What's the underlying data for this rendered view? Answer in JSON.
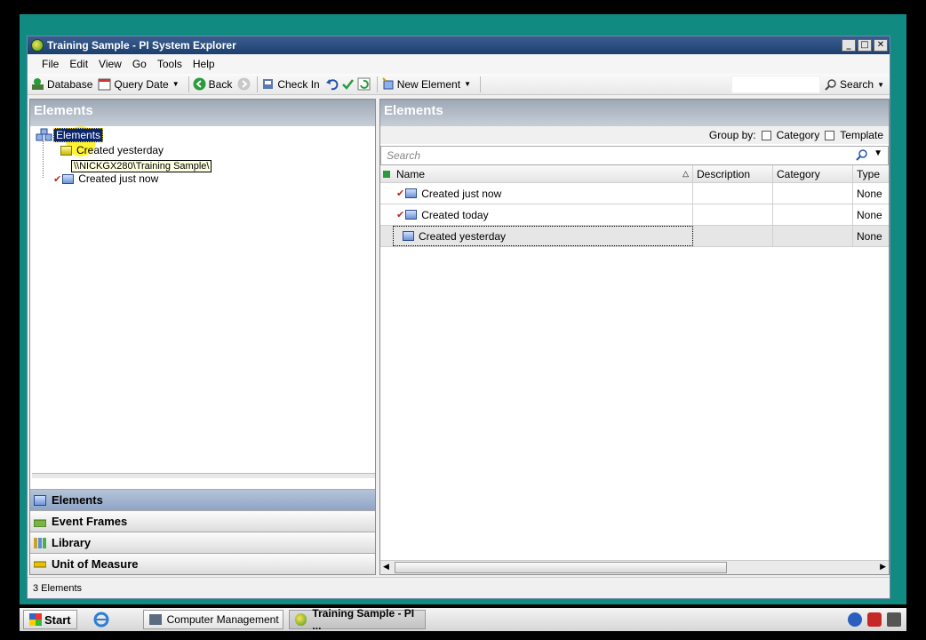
{
  "window": {
    "title": "Training Sample - PI System Explorer",
    "controls": {
      "minimize": "_",
      "maximize": "□",
      "close": "✕"
    }
  },
  "menu": [
    "File",
    "Edit",
    "View",
    "Go",
    "Tools",
    "Help"
  ],
  "toolbar": {
    "database": "Database",
    "query_date": "Query Date",
    "back": "Back",
    "check_in": "Check In",
    "new_element": "New Element",
    "search": "Search"
  },
  "left": {
    "header": "Elements",
    "tree_root": "Elements",
    "tree_items": [
      "Created yesterday",
      "Created just now"
    ],
    "tooltip": "\\\\NICKGX280\\Training Sample\\"
  },
  "nav": [
    "Elements",
    "Event Frames",
    "Library",
    "Unit of Measure"
  ],
  "right": {
    "header": "Elements",
    "group_by": "Group by:",
    "category": "Category",
    "template": "Template",
    "search_placeholder": "Search",
    "columns": [
      "Name",
      "Description",
      "Category",
      "Type"
    ],
    "rows": [
      {
        "name": "Created just now",
        "description": "",
        "category": "",
        "type": "None",
        "checked": true
      },
      {
        "name": "Created today",
        "description": "",
        "category": "",
        "type": "None",
        "checked": true
      },
      {
        "name": "Created yesterday",
        "description": "",
        "category": "",
        "type": "None",
        "checked": false
      }
    ]
  },
  "status": "3 Elements",
  "taskbar": {
    "start": "Start",
    "tasks": [
      "Computer Management",
      "Training Sample - PI ..."
    ]
  },
  "icons": [
    "database-icon",
    "calendar-icon",
    "back-icon",
    "forward-icon",
    "check-in-icon",
    "undo-icon",
    "checkmark-icon",
    "refresh-icon",
    "new-element-icon",
    "search-icon"
  ]
}
